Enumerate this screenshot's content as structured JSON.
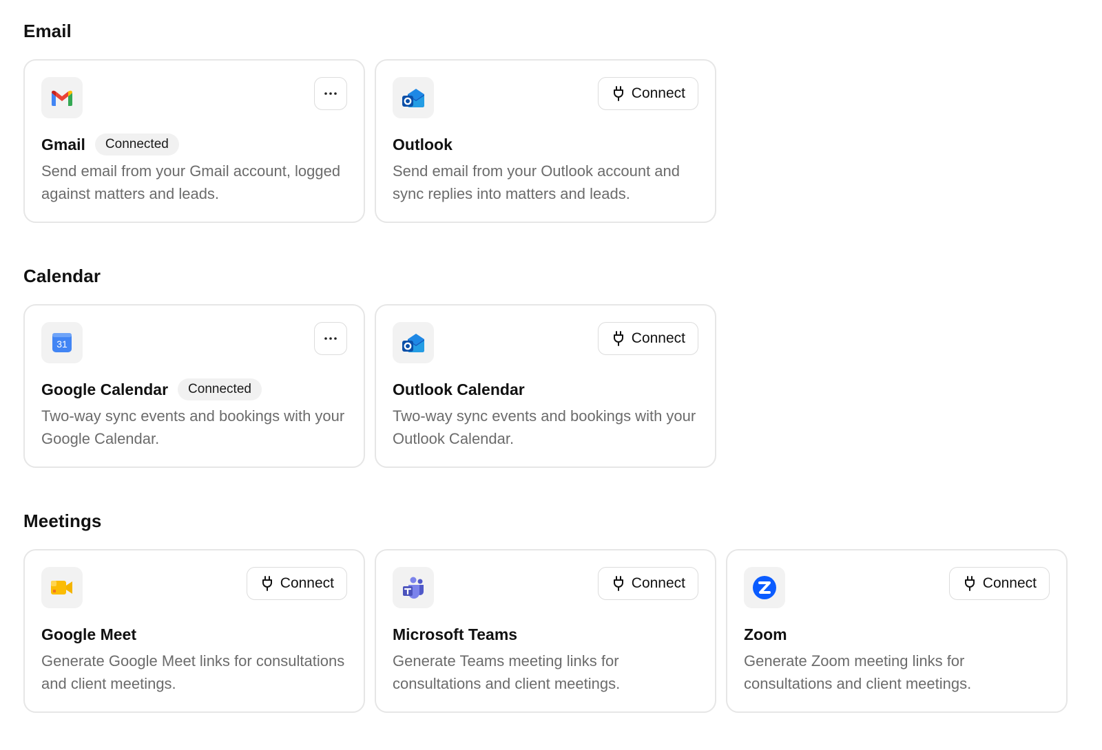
{
  "sections": {
    "email": {
      "title": "Email",
      "gmail": {
        "name": "Gmail",
        "status": "Connected",
        "description": "Send email from your Gmail account, logged against matters and leads.",
        "icon": "gmail-icon"
      },
      "outlook": {
        "name": "Outlook",
        "action": "Connect",
        "description": "Send email from your Outlook account and sync replies into matters and leads.",
        "icon": "outlook-icon"
      }
    },
    "calendar": {
      "title": "Calendar",
      "google_calendar": {
        "name": "Google Calendar",
        "status": "Connected",
        "description": "Two-way sync events and bookings with your Google Calendar.",
        "icon": "google-calendar-icon",
        "icon_text": "31"
      },
      "outlook_calendar": {
        "name": "Outlook Calendar",
        "action": "Connect",
        "description": "Two-way sync events and bookings with your Outlook Calendar.",
        "icon": "outlook-icon"
      }
    },
    "meetings": {
      "title": "Meetings",
      "google_meet": {
        "name": "Google Meet",
        "action": "Connect",
        "description": "Generate Google Meet links for consultations and client meetings.",
        "icon": "google-meet-icon"
      },
      "teams": {
        "name": "Microsoft Teams",
        "action": "Connect",
        "description": "Generate Teams meeting links for consultations and client meetings.",
        "icon": "microsoft-teams-icon"
      },
      "zoom": {
        "name": "Zoom",
        "action": "Connect",
        "description": "Generate Zoom meeting links for consultations and client meetings.",
        "icon": "zoom-icon"
      }
    }
  },
  "colors": {
    "card_border": "#e6e6e6",
    "badge_bg": "#f1f1f1",
    "description": "#6b6b6b",
    "zoom_blue": "#0B5CFF",
    "teams_purple": "#5B5FC7"
  }
}
